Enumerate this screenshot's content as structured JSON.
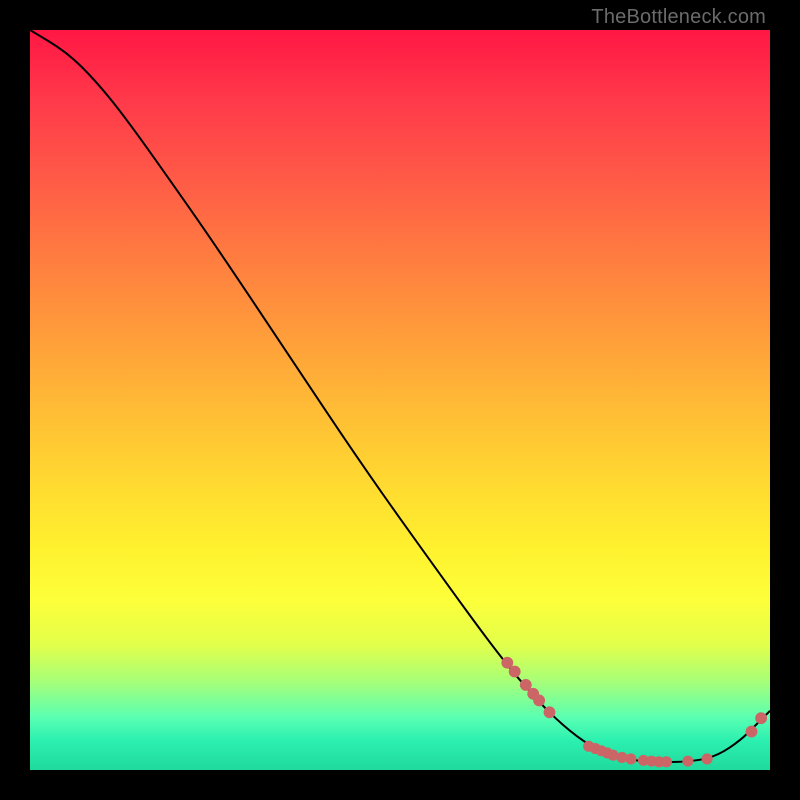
{
  "watermark": "TheBottleneck.com",
  "colors": {
    "curve_stroke": "#000000",
    "marker_fill": "#cc6666",
    "marker_stroke": "#cc6666"
  },
  "chart_data": {
    "type": "line",
    "title": "",
    "xlabel": "",
    "ylabel": "",
    "xlim": [
      0,
      100
    ],
    "ylim": [
      0,
      100
    ],
    "grid": false,
    "curve": [
      {
        "x": 0,
        "y": 100
      },
      {
        "x": 5,
        "y": 97
      },
      {
        "x": 9,
        "y": 93
      },
      {
        "x": 13,
        "y": 88
      },
      {
        "x": 18,
        "y": 81
      },
      {
        "x": 25,
        "y": 71
      },
      {
        "x": 35,
        "y": 56
      },
      {
        "x": 45,
        "y": 41
      },
      {
        "x": 55,
        "y": 27
      },
      {
        "x": 63,
        "y": 16
      },
      {
        "x": 68,
        "y": 10
      },
      {
        "x": 72,
        "y": 6
      },
      {
        "x": 76,
        "y": 3
      },
      {
        "x": 80,
        "y": 1.5
      },
      {
        "x": 85,
        "y": 1
      },
      {
        "x": 90,
        "y": 1.2
      },
      {
        "x": 93,
        "y": 2
      },
      {
        "x": 96,
        "y": 4
      },
      {
        "x": 98,
        "y": 6
      },
      {
        "x": 100,
        "y": 8
      }
    ],
    "markers_upper": [
      {
        "x": 64.5,
        "y": 14.5
      },
      {
        "x": 65.5,
        "y": 13.3
      },
      {
        "x": 67.0,
        "y": 11.5
      },
      {
        "x": 68.0,
        "y": 10.3
      },
      {
        "x": 68.8,
        "y": 9.4
      },
      {
        "x": 70.2,
        "y": 7.8
      }
    ],
    "markers_bottom": [
      {
        "x": 75.5,
        "y": 3.2
      },
      {
        "x": 76.4,
        "y": 2.9
      },
      {
        "x": 77.2,
        "y": 2.6
      },
      {
        "x": 78.0,
        "y": 2.3
      },
      {
        "x": 78.8,
        "y": 2.0
      },
      {
        "x": 80.0,
        "y": 1.7
      },
      {
        "x": 81.2,
        "y": 1.5
      },
      {
        "x": 82.9,
        "y": 1.3
      },
      {
        "x": 84.0,
        "y": 1.2
      },
      {
        "x": 85.0,
        "y": 1.1
      },
      {
        "x": 86.0,
        "y": 1.1
      },
      {
        "x": 88.9,
        "y": 1.2
      },
      {
        "x": 91.5,
        "y": 1.5
      }
    ],
    "markers_tail": [
      {
        "x": 97.5,
        "y": 5.2
      },
      {
        "x": 98.8,
        "y": 7.0
      }
    ]
  }
}
